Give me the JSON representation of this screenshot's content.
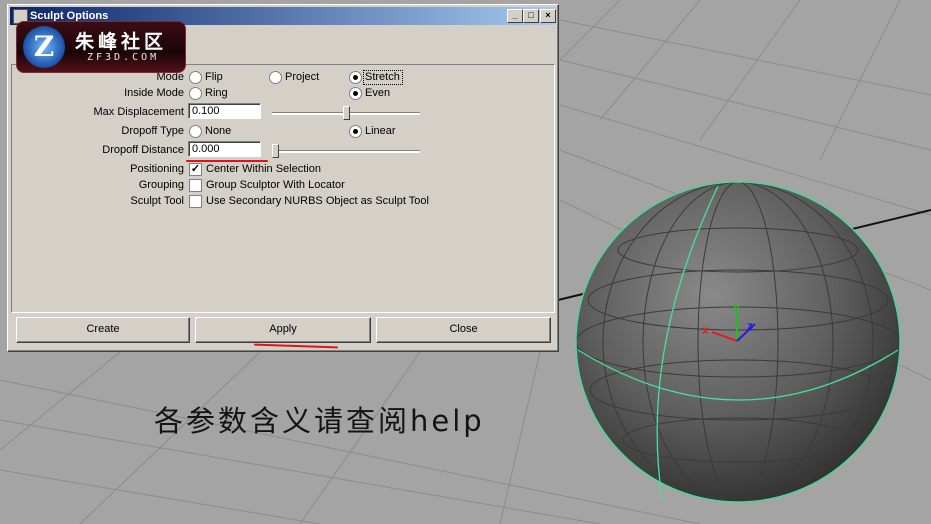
{
  "window": {
    "title": "Sculpt Options",
    "controls": [
      "_",
      "□",
      "×"
    ]
  },
  "logo": {
    "mark": "Z",
    "name": "朱峰社区",
    "site": "ZF3D.COM"
  },
  "form": {
    "mode": {
      "label": "Mode",
      "options": [
        {
          "label": "Flip",
          "selected": false
        },
        {
          "label": "Project",
          "selected": false
        },
        {
          "label": "Stretch",
          "selected": true
        }
      ]
    },
    "inside_mode": {
      "label": "Inside Mode",
      "options": [
        {
          "label": "Ring",
          "selected": false
        },
        {
          "label": "Even",
          "selected": true
        }
      ]
    },
    "max_displacement": {
      "label": "Max Displacement",
      "value": "0.100",
      "slider_fraction": 0.5
    },
    "dropoff_type": {
      "label": "Dropoff Type",
      "options": [
        {
          "label": "None",
          "selected": false
        },
        {
          "label": "Linear",
          "selected": true
        }
      ]
    },
    "dropoff_distance": {
      "label": "Dropoff Distance",
      "value": "0.000",
      "slider_fraction": 0.0
    },
    "positioning": {
      "label": "Positioning",
      "checkbox_label": "Center Within Selection",
      "checked": true
    },
    "grouping": {
      "label": "Grouping",
      "checkbox_label": "Group Sculptor With Locator",
      "checked": false
    },
    "sculpt_tool": {
      "label": "Sculpt Tool",
      "checkbox_label": "Use Secondary NURBS Object as Sculpt Tool",
      "checked": false
    }
  },
  "buttons": {
    "create": "Create",
    "apply": "Apply",
    "close": "Close"
  },
  "viewport": {
    "annotation": "各参数含义请查阅help",
    "axes": {
      "x": "x",
      "y": "y",
      "z": "z"
    },
    "colors": {
      "wire": "#44e0a0",
      "x_axis": "#e02020",
      "y_axis": "#20c020",
      "z_axis": "#2020e0",
      "highlight": "#e0121a"
    }
  }
}
